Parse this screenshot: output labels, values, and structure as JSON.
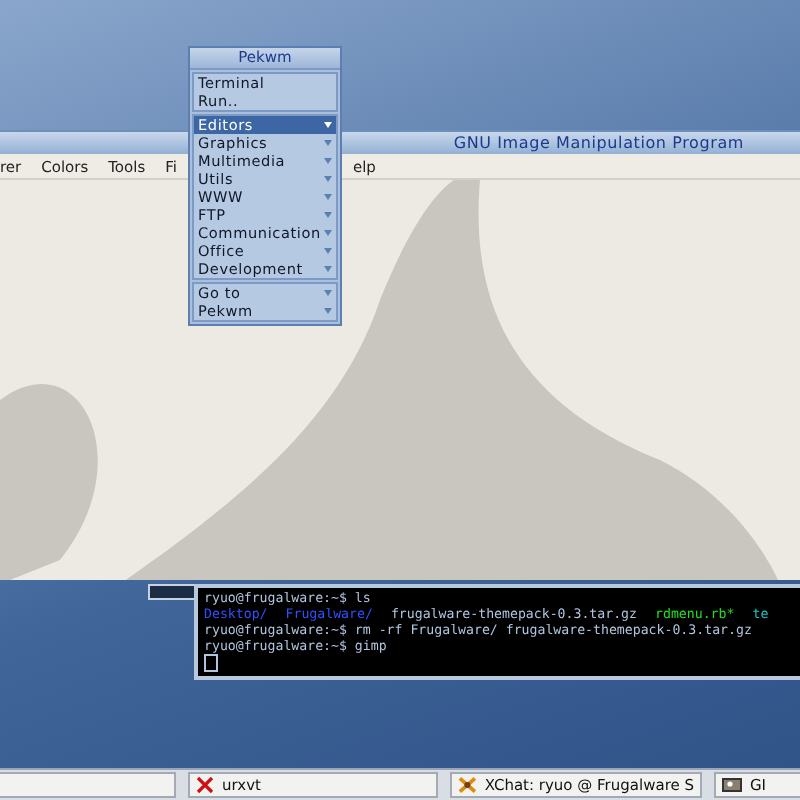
{
  "gimp_window": {
    "title": "GNU Image Manipulation Program",
    "menubar": [
      "rer",
      "Colors",
      "Tools",
      "Fi",
      "elp"
    ]
  },
  "root_menu": {
    "title": "Pekwm",
    "groups": [
      [
        {
          "label": "Terminal",
          "kind": "action",
          "selected": false
        },
        {
          "label": "Run..",
          "kind": "action",
          "selected": false
        }
      ],
      [
        {
          "label": "Editors",
          "kind": "submenu",
          "selected": true
        },
        {
          "label": "Graphics",
          "kind": "submenu",
          "selected": false
        },
        {
          "label": "Multimedia",
          "kind": "submenu",
          "selected": false
        },
        {
          "label": "Utils",
          "kind": "submenu",
          "selected": false
        },
        {
          "label": "WWW",
          "kind": "submenu",
          "selected": false
        },
        {
          "label": "FTP",
          "kind": "submenu",
          "selected": false
        },
        {
          "label": "Communication",
          "kind": "submenu",
          "selected": false
        },
        {
          "label": "Office",
          "kind": "submenu",
          "selected": false
        },
        {
          "label": "Development",
          "kind": "submenu",
          "selected": false
        }
      ],
      [
        {
          "label": "Go to",
          "kind": "submenu",
          "selected": false
        },
        {
          "label": "Pekwm",
          "kind": "submenu",
          "selected": false
        }
      ]
    ]
  },
  "terminal": {
    "lines": [
      [
        {
          "text": "ryuo@frugalware:~$ ls",
          "color": "#b0c4de"
        }
      ],
      [
        {
          "text": "Desktop/",
          "color": "#3050ff"
        },
        {
          "text": "Frugalware/",
          "color": "#3050ff"
        },
        {
          "text": "frugalware-themepack-0.3.tar.gz",
          "color": "#b0c4de"
        },
        {
          "text": "rdmenu.rb*",
          "color": "#20e020"
        },
        {
          "text": "te",
          "color": "#20c0c0"
        }
      ],
      [
        {
          "text": "ryuo@frugalware:~$ rm -rf Frugalware/ frugalware-themepack-0.3.tar.gz",
          "color": "#b0c4de"
        }
      ],
      [
        {
          "text": "ryuo@frugalware:~$ gimp",
          "color": "#b0c4de"
        }
      ]
    ]
  },
  "taskbar": [
    {
      "label": "urxvt",
      "kind": "terminal",
      "selected": false
    },
    {
      "label": "XChat: ryuo @ Frugalware S",
      "kind": "chat",
      "selected": false
    },
    {
      "label": "GI",
      "kind": "gimp",
      "selected": false
    }
  ]
}
